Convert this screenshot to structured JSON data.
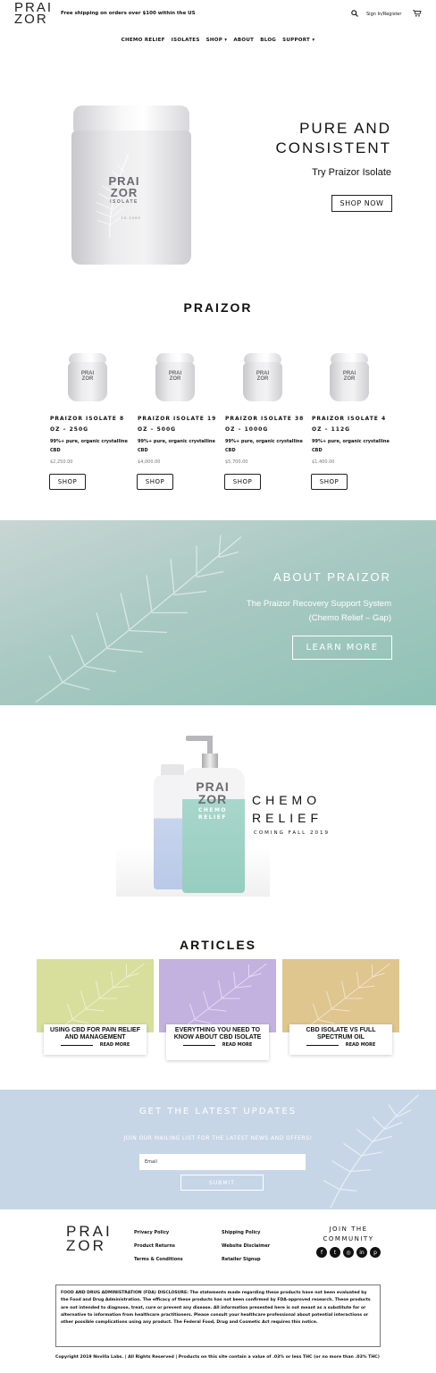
{
  "header": {
    "logo_line1": "PRAI",
    "logo_line2": "ZOR",
    "shipping_message": "Free shipping on orders over $100 within the US",
    "search_icon": "search-icon",
    "sign_in": "Sign In/Register",
    "cart_icon": "cart-icon"
  },
  "nav": {
    "items": [
      {
        "label": "CHEMO RELIEF"
      },
      {
        "label": "ISOLATES"
      },
      {
        "label": "SHOP ▾"
      },
      {
        "label": "ABOUT"
      },
      {
        "label": "BLOG"
      },
      {
        "label": "SUPPORT ▾"
      }
    ]
  },
  "hero": {
    "jar_brand1": "PRAI",
    "jar_brand2": "ZOR",
    "jar_brand3": "ISOLATE",
    "jar_small": "1 0 . 1 0 0 0",
    "title_line1": "PURE AND",
    "title_line2": "CONSISTENT",
    "subtitle": "Try Praizor Isolate",
    "cta": "SHOP NOW"
  },
  "products_section": {
    "title": "PRAIZOR",
    "products": [
      {
        "name1": "PRAIZOR ISOLATE 8",
        "name2": "OZ – 250G",
        "desc1": "99%+ pure, organic crystalline",
        "desc2": "CBD",
        "price": "$2,250.00",
        "button": "SHOP"
      },
      {
        "name1": "PRAIZOR ISOLATE 19",
        "name2": "OZ – 500G",
        "desc1": "99%+ pure, organic crystalline",
        "desc2": "CBD",
        "price": "$4,000.00",
        "button": "SHOP"
      },
      {
        "name1": "PRAIZOR ISOLATE 38",
        "name2": "OZ – 1000G",
        "desc1": "99%+ pure, organic crystalline",
        "desc2": "CBD",
        "price": "$5,700.00",
        "button": "SHOP"
      },
      {
        "name1": "PRAIZOR ISOLATE 4",
        "name2": "OZ – 112G",
        "desc1": "99%+ pure, organic crystalline",
        "desc2": "CBD",
        "price": "$1,400.00",
        "button": "SHOP"
      }
    ]
  },
  "about": {
    "title": "ABOUT PRAIZOR",
    "sub_line1": "The Praizor Recovery Support System",
    "sub_line2": "(Chemo Relief – Gap)",
    "cta": "LEARN MORE"
  },
  "chemo": {
    "title_line1": "CHEMO",
    "title_line2": "RELIEF",
    "subtitle": "COMING FALL 2019",
    "bottle_brand1": "PRAI",
    "bottle_brand2": "ZOR",
    "bottle_label1": "CHEMO",
    "bottle_label2": "RELIEF"
  },
  "articles": {
    "title": "ARTICLES",
    "items": [
      {
        "title": "USING CBD FOR PAIN RELIEF AND MANAGEMENT",
        "link": "READ MORE",
        "color": "#d8de9c"
      },
      {
        "title": "EVERYTHING YOU NEED TO KNOW ABOUT CBD ISOLATE",
        "link": "READ MORE",
        "color": "#c3b1e0"
      },
      {
        "title": "CBD ISOLATE VS FULL SPECTRUM OIL",
        "link": "READ MORE",
        "color": "#dfc58e"
      }
    ]
  },
  "newsletter": {
    "title": "GET THE LATEST UPDATES",
    "subtitle": "JOIN OUR MAILING LIST FOR THE LATEST NEWS AND OFFERS!",
    "email_placeholder": "Email",
    "submit": "SUBMIT"
  },
  "footer": {
    "logo_line1": "PRAI",
    "logo_line2": "ZOR",
    "col1": [
      "Privacy Policy",
      "Product Returns",
      "Terms & Conditions"
    ],
    "col2": [
      "Shipping Policy",
      "Website Disclaimer",
      "Retailer Signup"
    ],
    "join_line1": "JOIN THE",
    "join_line2": "COMMUNITY",
    "social": [
      {
        "icon": "facebook-icon",
        "glyph": "f"
      },
      {
        "icon": "twitter-icon",
        "glyph": "t"
      },
      {
        "icon": "instagram-icon",
        "glyph": "◎"
      },
      {
        "icon": "linkedin-icon",
        "glyph": "in"
      },
      {
        "icon": "pinterest-icon",
        "glyph": "p"
      }
    ],
    "disclaimer": "FOOD AND DRUG ADMINISTRATION (FDA) DISCLOSURE: The statements made regarding these products have not been evaluated by the Food and Drug Administration. The efficacy of these products has not been confirmed by FDA-approved research. These products are not intended to diagnose, treat, cure or prevent any disease. All information presented here is not meant as a substitute for or alternative to information from healthcare practitioners. Please consult your healthcare professional about potential interactions or other possible complications using any product. The Federal Food, Drug and Cosmetic Act requires this notice.",
    "copyright": "Copyright 2019 Novilla Labs. | All Rights Reserved | Products on this site contain a value of .03% or less THC (or no more than .03% THC)"
  }
}
